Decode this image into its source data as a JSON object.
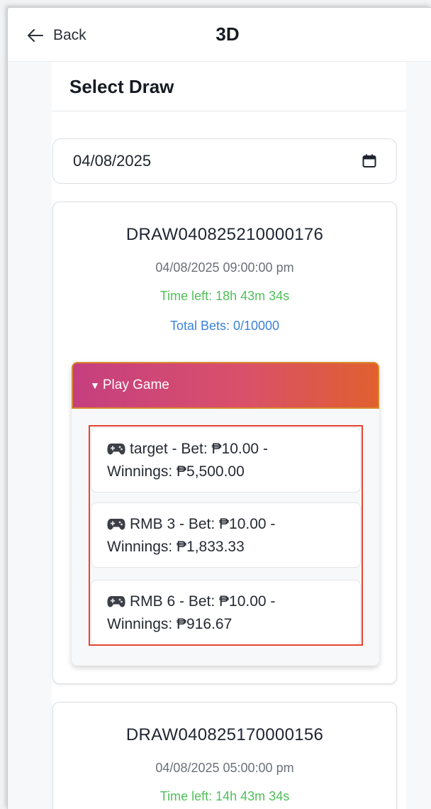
{
  "header": {
    "back_label": "Back",
    "title": "3D"
  },
  "section": {
    "title": "Select Draw"
  },
  "date_picker": {
    "value": "04/08/2025"
  },
  "draws": [
    {
      "id": "DRAW040825210000176",
      "datetime": "04/08/2025 09:00:00 pm",
      "time_left": "Time left: 18h 43m 34s",
      "total_bets": "Total Bets: 0/10000",
      "play_game_label": "Play Game",
      "games": [
        {
          "line1": "target - Bet: ₱10.00 -",
          "line2": "Winnings: ₱5,500.00"
        },
        {
          "line1": "RMB 3 - Bet: ₱10.00 -",
          "line2": "Winnings: ₱1,833.33"
        },
        {
          "line1": "RMB 6 - Bet: ₱10.00 -",
          "line2": "Winnings: ₱916.67"
        }
      ]
    },
    {
      "id": "DRAW040825170000156",
      "datetime": "04/08/2025 05:00:00 pm",
      "time_left": "Time left: 14h 43m 34s"
    }
  ],
  "colors": {
    "time_left": "#4fbf59",
    "total_bets": "#3b82d6",
    "play_gradient_start": "#c53f7f",
    "play_gradient_end": "#e0602f",
    "highlight": "#e8432e"
  },
  "icons": {
    "back": "arrow-left-icon",
    "calendar": "calendar-icon",
    "game": "gamepad-icon"
  }
}
